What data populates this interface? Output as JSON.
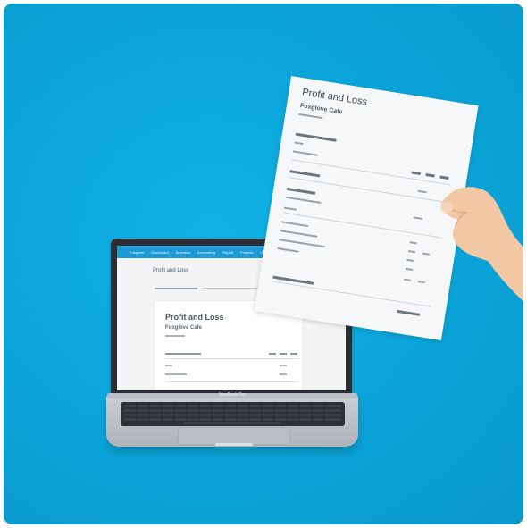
{
  "laptop": {
    "nav_items": [
      "Foxglove",
      "Dashboard",
      "Business",
      "Accounting",
      "Payroll",
      "Projects",
      "Contacts"
    ],
    "page_title": "Profit and Loss",
    "report_title": "Profit and Loss",
    "report_company": "Foxglove Cafe",
    "model_label": "MacBook Pro"
  },
  "paper": {
    "report_title": "Profit and Loss",
    "report_company": "Foxglove Cafe"
  },
  "colors": {
    "background": "#0aa5d9",
    "app_nav": "#1e9ad6"
  }
}
